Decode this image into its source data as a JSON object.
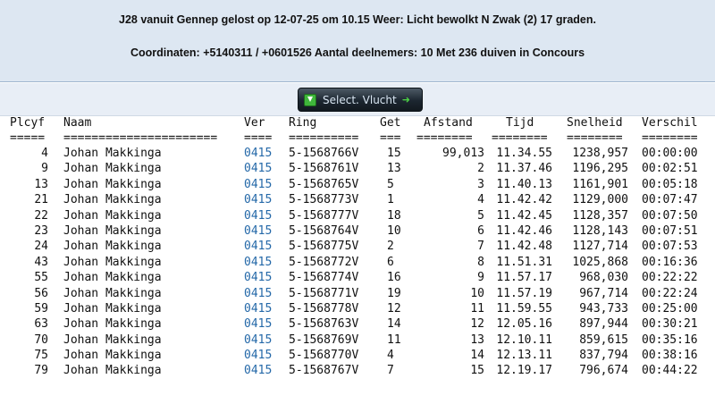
{
  "header": {
    "line1": "J28 vanuit Gennep gelost op 12-07-25 om 10.15 Weer: Licht bewolkt N Zwak (2) 17 graden.",
    "line2": "Coordinaten: +5140311 / +0601526 Aantal deelnemers: 10 Met 236 duiven in Concours"
  },
  "button": {
    "label": "Select. Vlucht",
    "icon": "download-icon",
    "arrow_icon": "arrow-right-icon"
  },
  "table": {
    "columns": {
      "plcyf": "Plcyf",
      "naam": "Naam",
      "ver": "Ver",
      "ring": "Ring",
      "get": "Get",
      "afstand": "Afstand",
      "tijd": "Tijd",
      "snelheid": "Snelheid",
      "verschil": "Verschil"
    },
    "separators": {
      "plcyf": "=====",
      "naam": "======================",
      "ver": "====",
      "ring": "==========",
      "get": "===",
      "afstand": "========",
      "tijd": "========",
      "snelheid": "========",
      "verschil": "========"
    },
    "rows": [
      {
        "plcyf": "4",
        "naam": "Johan Makkinga",
        "ver": "0415",
        "ring": "5-1568766V",
        "get": "15",
        "afstand": "99,013",
        "tijd": "11.34.55",
        "snelheid": "1238,957",
        "verschil": "00:00:00"
      },
      {
        "plcyf": "9",
        "naam": "Johan Makkinga",
        "ver": "0415",
        "ring": "5-1568761V",
        "get": "13",
        "afstand": "2",
        "tijd": "11.37.46",
        "snelheid": "1196,295",
        "verschil": "00:02:51"
      },
      {
        "plcyf": "13",
        "naam": "Johan Makkinga",
        "ver": "0415",
        "ring": "5-1568765V",
        "get": "5",
        "afstand": "3",
        "tijd": "11.40.13",
        "snelheid": "1161,901",
        "verschil": "00:05:18"
      },
      {
        "plcyf": "21",
        "naam": "Johan Makkinga",
        "ver": "0415",
        "ring": "5-1568773V",
        "get": "1",
        "afstand": "4",
        "tijd": "11.42.42",
        "snelheid": "1129,000",
        "verschil": "00:07:47"
      },
      {
        "plcyf": "22",
        "naam": "Johan Makkinga",
        "ver": "0415",
        "ring": "5-1568777V",
        "get": "18",
        "afstand": "5",
        "tijd": "11.42.45",
        "snelheid": "1128,357",
        "verschil": "00:07:50"
      },
      {
        "plcyf": "23",
        "naam": "Johan Makkinga",
        "ver": "0415",
        "ring": "5-1568764V",
        "get": "10",
        "afstand": "6",
        "tijd": "11.42.46",
        "snelheid": "1128,143",
        "verschil": "00:07:51"
      },
      {
        "plcyf": "24",
        "naam": "Johan Makkinga",
        "ver": "0415",
        "ring": "5-1568775V",
        "get": "2",
        "afstand": "7",
        "tijd": "11.42.48",
        "snelheid": "1127,714",
        "verschil": "00:07:53"
      },
      {
        "plcyf": "43",
        "naam": "Johan Makkinga",
        "ver": "0415",
        "ring": "5-1568772V",
        "get": "6",
        "afstand": "8",
        "tijd": "11.51.31",
        "snelheid": "1025,868",
        "verschil": "00:16:36"
      },
      {
        "plcyf": "55",
        "naam": "Johan Makkinga",
        "ver": "0415",
        "ring": "5-1568774V",
        "get": "16",
        "afstand": "9",
        "tijd": "11.57.17",
        "snelheid": "968,030",
        "verschil": "00:22:22"
      },
      {
        "plcyf": "56",
        "naam": "Johan Makkinga",
        "ver": "0415",
        "ring": "5-1568771V",
        "get": "19",
        "afstand": "10",
        "tijd": "11.57.19",
        "snelheid": "967,714",
        "verschil": "00:22:24"
      },
      {
        "plcyf": "59",
        "naam": "Johan Makkinga",
        "ver": "0415",
        "ring": "5-1568778V",
        "get": "12",
        "afstand": "11",
        "tijd": "11.59.55",
        "snelheid": "943,733",
        "verschil": "00:25:00"
      },
      {
        "plcyf": "63",
        "naam": "Johan Makkinga",
        "ver": "0415",
        "ring": "5-1568763V",
        "get": "14",
        "afstand": "12",
        "tijd": "12.05.16",
        "snelheid": "897,944",
        "verschil": "00:30:21"
      },
      {
        "plcyf": "70",
        "naam": "Johan Makkinga",
        "ver": "0415",
        "ring": "5-1568769V",
        "get": "11",
        "afstand": "13",
        "tijd": "12.10.11",
        "snelheid": "859,615",
        "verschil": "00:35:16"
      },
      {
        "plcyf": "75",
        "naam": "Johan Makkinga",
        "ver": "0415",
        "ring": "5-1568770V",
        "get": "4",
        "afstand": "14",
        "tijd": "12.13.11",
        "snelheid": "837,794",
        "verschil": "00:38:16"
      },
      {
        "plcyf": "79",
        "naam": "Johan Makkinga",
        "ver": "0415",
        "ring": "5-1568767V",
        "get": "7",
        "afstand": "15",
        "tijd": "12.19.17",
        "snelheid": "796,674",
        "verschil": "00:44:22"
      }
    ]
  }
}
